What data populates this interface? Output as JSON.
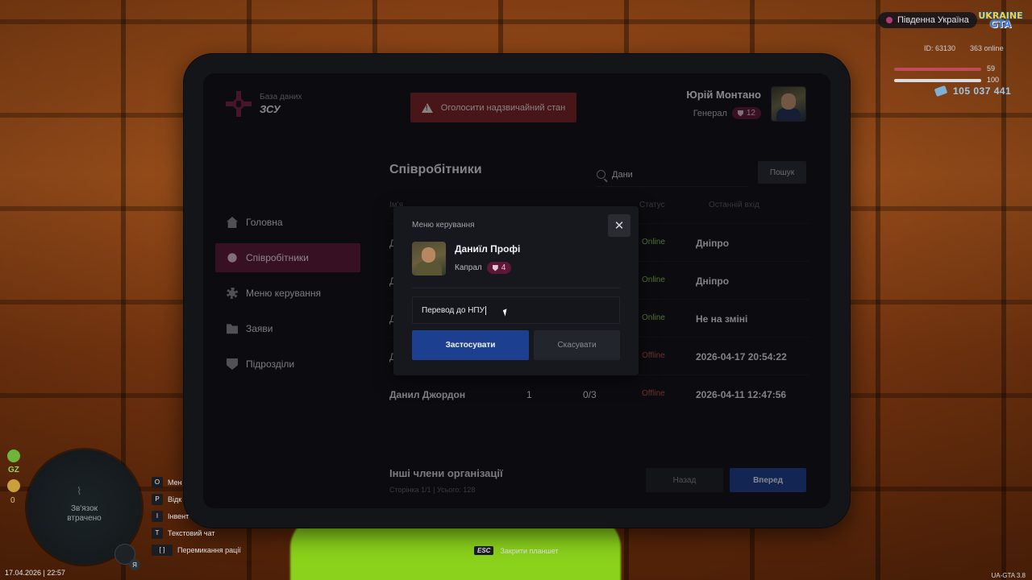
{
  "hud": {
    "server": "Південна Україна",
    "logo_line1": "UKRAINE",
    "logo_line2": "GTA",
    "id_label": "ID: 63130",
    "online": "363 online",
    "health": "59",
    "armor": "100",
    "money": "105 037 441",
    "colors": {
      "health": "#c24a5a",
      "armor": "#dcdce0"
    }
  },
  "tablet": {
    "brand_sub": "База даних",
    "brand_main": "ЗСУ",
    "emergency_button": "Оголосити надзвичайний стан",
    "user": {
      "name": "Юрій Монтано",
      "rank": "Генерал",
      "level": "12"
    },
    "nav": [
      {
        "label": "Головна",
        "icon": "home-icon"
      },
      {
        "label": "Співробітники",
        "icon": "users-icon",
        "active": true
      },
      {
        "label": "Меню керування",
        "icon": "gear-icon"
      },
      {
        "label": "Заяви",
        "icon": "folder-icon"
      },
      {
        "label": "Підрозділи",
        "icon": "shield-icon"
      }
    ],
    "section_title": "Співробітники",
    "search": {
      "value": "Дани",
      "button": "Пошук"
    },
    "table": {
      "headers": {
        "name": "Ім'я",
        "status": "Статус",
        "last": "Останній вхід"
      },
      "rows": [
        {
          "name": "Д",
          "status": "Online",
          "last": "Дніпро"
        },
        {
          "name": "Д",
          "status": "Online",
          "last": "Дніпро"
        },
        {
          "name": "Д",
          "status": "Online",
          "last": "Не на зміні"
        },
        {
          "name": "Д",
          "status": "Offline",
          "last": "2026-04-17 20:54:22"
        },
        {
          "name": "Данил Джордон",
          "rank": "1",
          "warns": "0/3",
          "status": "Offline",
          "last": "2026-04-11 12:47:56"
        }
      ]
    },
    "others_title": "Інші члени організації",
    "others_sub": "Сторінка 1/1 | Усього: 128",
    "back": "Назад",
    "next": "Вперед"
  },
  "modal": {
    "title": "Меню керування",
    "name": "Даниїл Профі",
    "rank": "Капрал",
    "level": "4",
    "input_value": "Перевод до НПУ",
    "apply": "Застосувати",
    "cancel": "Скасувати",
    "close": "✕"
  },
  "bottom": {
    "gz": "GZ",
    "zero": "0",
    "radar_lost": "Зв'язок\nвтрачено",
    "mic_key": "Я",
    "keys": [
      {
        "k": "O",
        "label": "Мен"
      },
      {
        "k": "P",
        "label": "Відк"
      },
      {
        "k": "I",
        "label": "Інвент"
      },
      {
        "k": "T",
        "label": "Текстовий чат"
      },
      {
        "k": "[ ]",
        "label": "Перемикання рації"
      }
    ],
    "date": "17.04.2026 | 22:57",
    "esc_key": "ESC",
    "esc_label": "Закрити планшет",
    "version": "UA-GTA 3.8"
  }
}
